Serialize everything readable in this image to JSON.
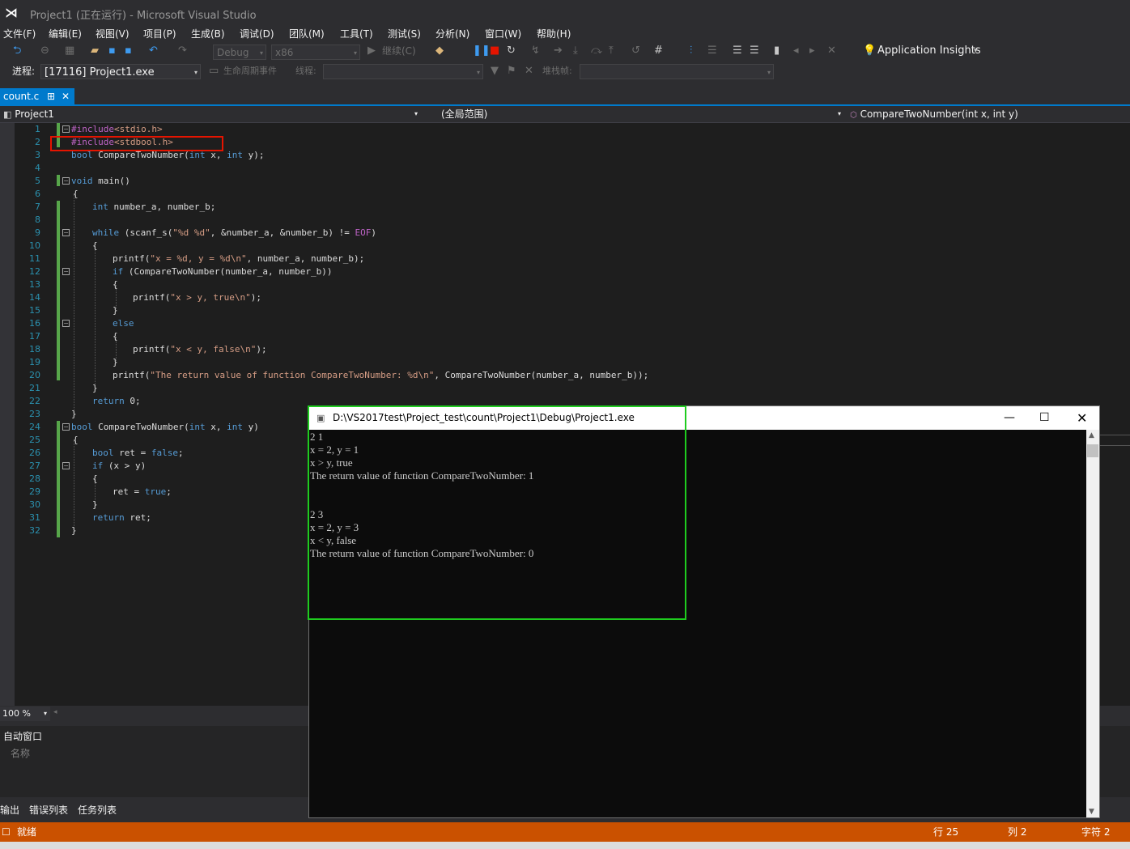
{
  "window": {
    "title": "Project1 (正在运行) - Microsoft Visual Studio"
  },
  "menu": [
    "文件(F)",
    "编辑(E)",
    "视图(V)",
    "项目(P)",
    "生成(B)",
    "调试(D)",
    "团队(M)",
    "工具(T)",
    "测试(S)",
    "分析(N)",
    "窗口(W)",
    "帮助(H)"
  ],
  "toolbar": {
    "config": "Debug",
    "platform": "x86",
    "continue_label": "继续(C)",
    "app_insights": "Application Insights"
  },
  "debug_toolbar": {
    "process_label": "进程:",
    "process_value": "[17116] Project1.exe",
    "lifecycle_label": "生命周期事件",
    "thread_label": "线程:",
    "stackframe_label": "堆栈帧:"
  },
  "tabs": [
    {
      "label": "count.c",
      "pin": "⊞",
      "close": "✕"
    }
  ],
  "navbar": {
    "project": "Project1",
    "scope": "(全局范围)",
    "member": "CompareTwoNumber(int x, int y)"
  },
  "editor": {
    "line_numbers": [
      "1",
      "2",
      "3",
      "4",
      "5",
      "6",
      "7",
      "8",
      "9",
      "10",
      "11",
      "12",
      "13",
      "14",
      "15",
      "16",
      "17",
      "18",
      "19",
      "20",
      "21",
      "22",
      "23",
      "24",
      "25",
      "26",
      "27",
      "28",
      "29",
      "30",
      "31",
      "32"
    ]
  },
  "zoom": "100 %",
  "autos": {
    "title": "自动窗口",
    "column_name": "名称"
  },
  "bottom_tabs": [
    "输出",
    "错误列表",
    "任务列表"
  ],
  "status": {
    "ready": "就绪",
    "row": "行 25",
    "col": "列 2",
    "char": "字符 2"
  },
  "console": {
    "title": "D:\\VS2017test\\Project_test\\count\\Project1\\Debug\\Project1.exe",
    "lines": [
      "2 1",
      "x = 2, y = 1",
      "x > y, true",
      "The return value of function CompareTwoNumber: 1",
      "",
      "",
      "2 3",
      "x = 2, y = 3",
      "x < y, false",
      "The return value of function CompareTwoNumber: 0"
    ]
  }
}
